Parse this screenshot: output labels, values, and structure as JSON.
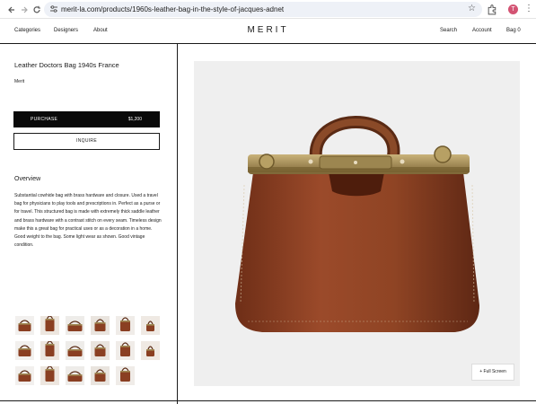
{
  "browser": {
    "url": "merit-la.com/products/1960s-leather-bag-in-the-style-of-jacques-adnet",
    "profile_initial": "T",
    "icons": [
      "back-icon",
      "forward-icon",
      "reload-icon",
      "site-info-icon",
      "star-icon",
      "extensions-icon",
      "kebab-menu-icon"
    ]
  },
  "header": {
    "nav_left": [
      "Categories",
      "Designers",
      "About"
    ],
    "logo": "MERIT",
    "nav_right": [
      "Search",
      "Account",
      "Bag 0"
    ]
  },
  "product": {
    "title": "Leather Doctors Bag 1940s France",
    "designer": "Merit",
    "purchase_label": "PURCHASE",
    "price": "$1,200",
    "inquire_label": "INQUIRE",
    "overview_heading": "Overview",
    "overview_text": "Substantial cowhide bag with brass hardware and closure. Used a travel bag for physicians to play tools and prescriptions in. Perfect as a purse or for travel. This structured bag is made with extremely thick saddle leather and brass hardware with a contrast stitch on every seam. Timeless design make this a great bag for practical uses or as a decoration in a home. Good weight to the bag. Some light wear as shown. Good vintage condition.",
    "thumbnail_count": 17
  },
  "gallery": {
    "fullscreen_label": "+ Full Screen"
  },
  "colors": {
    "leather": "#8a3f22",
    "brass": "#a08a55",
    "accent_black": "#0a0a0a",
    "profile": "#d35373"
  }
}
